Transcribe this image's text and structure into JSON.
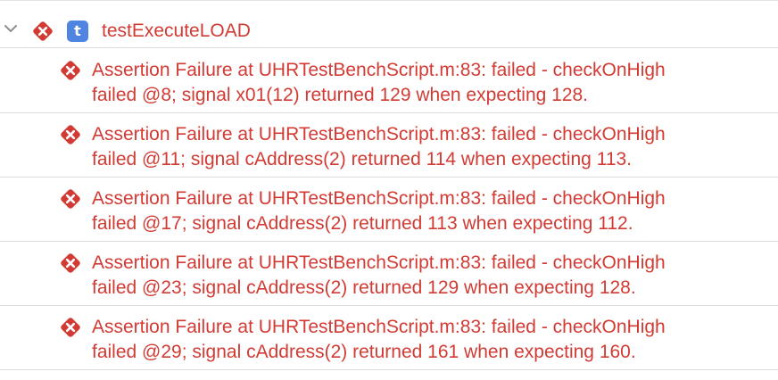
{
  "test": {
    "name": "testExecuteLOAD",
    "badge_letter": "t",
    "disclosure_icon": "chevron-down-icon",
    "status_icon": "failure-x-icon"
  },
  "failures": [
    {
      "line1": "Assertion Failure at UHRTestBenchScript.m:83: failed - checkOnHigh",
      "line2": "failed @8; signal x01(12) returned 129 when expecting 128."
    },
    {
      "line1": "Assertion Failure at UHRTestBenchScript.m:83: failed - checkOnHigh",
      "line2": "failed @11; signal cAddress(2) returned 114 when expecting 113."
    },
    {
      "line1": "Assertion Failure at UHRTestBenchScript.m:83: failed - checkOnHigh",
      "line2": "failed @17; signal cAddress(2) returned 113 when expecting 112."
    },
    {
      "line1": "Assertion Failure at UHRTestBenchScript.m:83: failed - checkOnHigh",
      "line2": "failed @23; signal cAddress(2) returned 129 when expecting 128."
    },
    {
      "line1": "Assertion Failure at UHRTestBenchScript.m:83: failed - checkOnHigh",
      "line2": "failed @29; signal cAddress(2) returned 161 when expecting 160."
    }
  ],
  "colors": {
    "failure_red": "#d23b34",
    "badge_blue": "#4f84e0",
    "separator": "#dcdcdc",
    "disclosure_gray": "#8e8e93"
  }
}
